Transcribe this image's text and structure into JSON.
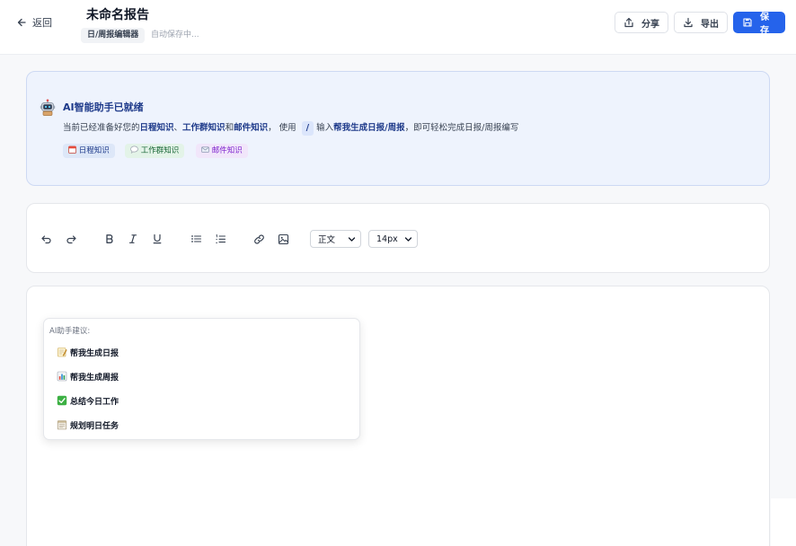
{
  "header": {
    "back_label": "返回",
    "title": "未命名报告",
    "tag": "日/周报编辑器",
    "autosave": "自动保存中...",
    "share_label": "分享",
    "export_label": "导出",
    "save_label": "保存"
  },
  "ai": {
    "title": "AI智能助手已就绪",
    "desc_prefix": "当前已经准备好您的",
    "k1": "日程知识",
    "sep1": "、",
    "k2": "工作群知识",
    "sep2": "和",
    "k3": "邮件知识",
    "desc_mid": "， 使用",
    "slash": "/",
    "desc_mid2": "输入",
    "cmd": "帮我生成日报/周报",
    "desc_suffix": "，即可轻松完成日报/周报编写",
    "chips": [
      {
        "icon": "calendar-icon",
        "label": "日程知识"
      },
      {
        "icon": "chat-bubble-icon",
        "label": "工作群知识"
      },
      {
        "icon": "mail-icon",
        "label": "邮件知识"
      }
    ],
    "colors": {
      "accent": "#2563eb",
      "banner_bg": "#eef3fd",
      "title": "#1e3a8a"
    }
  },
  "toolbar": {
    "icons": [
      "undo-icon",
      "redo-icon",
      "bold-icon",
      "italic-icon",
      "underline-icon",
      "bullet-list-icon",
      "numbered-list-icon",
      "link-icon",
      "image-icon"
    ],
    "paragraph_style": "正文",
    "font_size": "14px"
  },
  "suggestions": {
    "title": "AI助手建议:",
    "items": [
      {
        "icon": "memo-icon",
        "label": "帮我生成日报"
      },
      {
        "icon": "bar-chart-icon",
        "label": "帮我生成周报"
      },
      {
        "icon": "check-box-icon",
        "label": "总结今日工作"
      },
      {
        "icon": "calendar-tearoff-icon",
        "label": "规划明日任务"
      }
    ]
  }
}
